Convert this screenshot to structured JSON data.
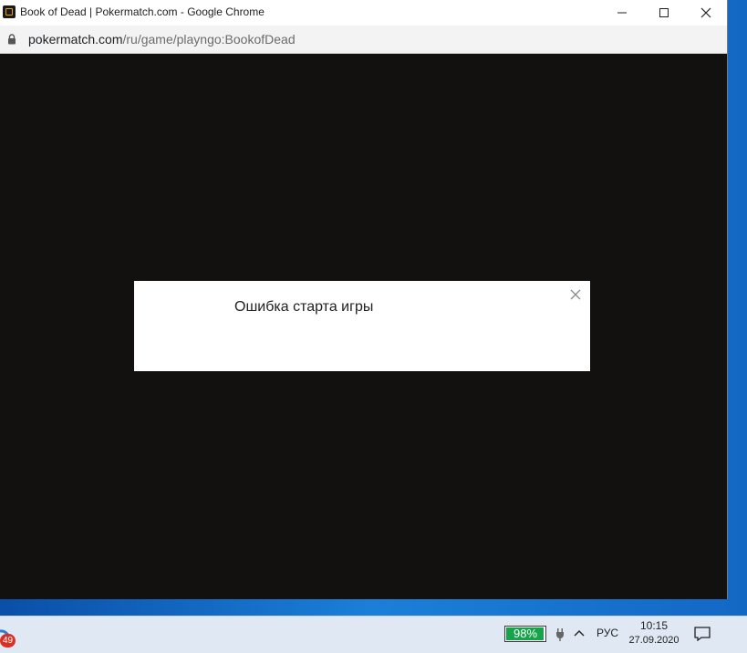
{
  "window": {
    "title": "Book of Dead | Pokermatch.com - Google Chrome",
    "controls": {
      "minimize": "minimize",
      "maximize": "maximize",
      "close": "close"
    }
  },
  "address": {
    "host": "pokermatch.com",
    "path": "/ru/game/playngo:BookofDead"
  },
  "dialog": {
    "message": "Ошибка старта игры"
  },
  "taskbar": {
    "badge_count": "49",
    "battery_text": "98%",
    "battery_level": 0.98,
    "language": "РУС",
    "time": "10:15",
    "date": "27.09.2020"
  },
  "colors": {
    "content_bg": "#121110",
    "battery_fill": "#16a34a",
    "badge": "#d93025"
  },
  "icons": [
    "favicon-icon",
    "minimize-icon",
    "maximize-icon",
    "close-icon",
    "lock-icon",
    "dialog-close-icon",
    "plug-icon",
    "chevron-up-icon",
    "notification-icon"
  ]
}
